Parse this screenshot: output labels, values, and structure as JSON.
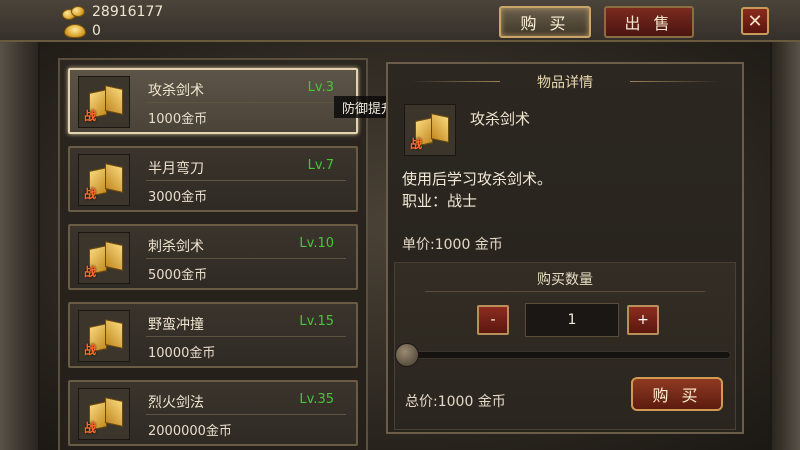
{
  "currency": {
    "gold_amount": "28916177",
    "ingot_amount": "0"
  },
  "tabs": {
    "buy": "购 买",
    "sell": "出 售"
  },
  "close_icon": "✕",
  "items": [
    {
      "name": "攻杀剑术",
      "level": "Lv.3",
      "price": "1000金币",
      "class_tag": "战"
    },
    {
      "name": "半月弯刀",
      "level": "Lv.7",
      "price": "3000金币",
      "class_tag": "战"
    },
    {
      "name": "刺杀剑术",
      "level": "Lv.10",
      "price": "5000金币",
      "class_tag": "战"
    },
    {
      "name": "野蛮冲撞",
      "level": "Lv.15",
      "price": "10000金币",
      "class_tag": "战"
    },
    {
      "name": "烈火剑法",
      "level": "Lv.35",
      "price": "2000000金币",
      "class_tag": "战"
    }
  ],
  "tooltip": "防御提升效果消失",
  "detail": {
    "title": "物品详情",
    "name": "攻杀剑术",
    "class_tag": "战",
    "description_line1": "使用后学习攻杀剑术。",
    "description_line2": "职业：战士",
    "unit_price": "单价:1000 金币"
  },
  "purchase": {
    "title": "购买数量",
    "minus": "-",
    "plus": "+",
    "quantity": "1",
    "total_price": "总价:1000 金币",
    "buy_label": "购 买"
  },
  "colors": {
    "level_green": "#48c43a",
    "class_tag_orange": "#ff6a2a",
    "button_red": "#8c2c1f"
  }
}
